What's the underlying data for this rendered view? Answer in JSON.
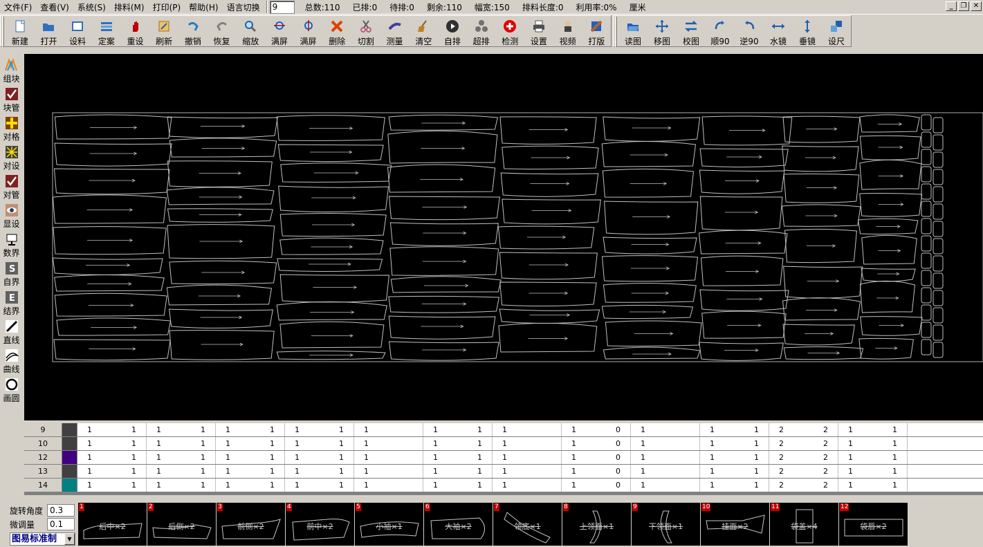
{
  "menu": {
    "items": [
      "文件(F)",
      "查看(V)",
      "系统(S)",
      "排料(M)",
      "打印(P)",
      "帮助(H)",
      "语言切换"
    ],
    "layer_value": "9",
    "stats": [
      "总数:110",
      "已排:0",
      "待排:0",
      "剩余:110",
      "幅宽:150",
      "排料长度:0",
      "利用率:0%",
      "厘米"
    ]
  },
  "window_buttons": [
    "_",
    "❐",
    "✕"
  ],
  "toolbar": {
    "group1": [
      {
        "label": "新建",
        "icon": "new-file-icon",
        "color": "#3070c0"
      },
      {
        "label": "打开",
        "icon": "open-folder-icon",
        "color": "#3070c0"
      },
      {
        "label": "设料",
        "icon": "material-icon",
        "color": "#3070c0"
      },
      {
        "label": "定案",
        "icon": "layout-icon",
        "color": "#3070c0"
      },
      {
        "label": "重设",
        "icon": "hand-icon",
        "color": "#c00000"
      },
      {
        "label": "刷新",
        "icon": "refresh-icon",
        "color": "#a07020"
      },
      {
        "label": "撤销",
        "icon": "undo-icon",
        "color": "#2080c0"
      },
      {
        "label": "恢复",
        "icon": "redo-icon",
        "color": "#808080"
      },
      {
        "label": "缩放",
        "icon": "zoom-icon",
        "color": "#2060b0"
      },
      {
        "label": "满屏",
        "icon": "fit-screen-icon",
        "color": "#2060b0"
      },
      {
        "label": "满屏",
        "icon": "fit-screen-v-icon",
        "color": "#2060b0"
      },
      {
        "label": "删除",
        "icon": "delete-icon",
        "color": "#e04000"
      },
      {
        "label": "切割",
        "icon": "cut-icon",
        "color": "#c06080"
      },
      {
        "label": "测量",
        "icon": "measure-icon",
        "color": "#4040a0"
      },
      {
        "label": "清空",
        "icon": "broom-icon",
        "color": "#c08020"
      },
      {
        "label": "自排",
        "icon": "play-icon",
        "color": "#303030"
      },
      {
        "label": "超排",
        "icon": "cluster-icon",
        "color": "#707070"
      },
      {
        "label": "检测",
        "icon": "check-icon",
        "color": "#e00000"
      },
      {
        "label": "设置",
        "icon": "printer-icon",
        "color": "#505050"
      },
      {
        "label": "视频",
        "icon": "video-icon",
        "color": "#404040"
      },
      {
        "label": "打版",
        "icon": "pattern-icon",
        "color": "#c06020"
      }
    ],
    "group2": [
      {
        "label": "读图",
        "icon": "read-folder-icon",
        "color": "#2060b0"
      },
      {
        "label": "移图",
        "icon": "move-icon",
        "color": "#2060b0"
      },
      {
        "label": "校图",
        "icon": "swap-icon",
        "color": "#2060b0"
      },
      {
        "label": "顺90",
        "icon": "rotate-cw-icon",
        "color": "#2060b0"
      },
      {
        "label": "逆90",
        "icon": "rotate-ccw-icon",
        "color": "#2060b0"
      },
      {
        "label": "水镜",
        "icon": "mirror-h-icon",
        "color": "#2060b0"
      },
      {
        "label": "垂镜",
        "icon": "mirror-v-icon",
        "color": "#2060b0"
      },
      {
        "label": "设尺",
        "icon": "ruler-icon",
        "color": "#2060b0"
      }
    ]
  },
  "sidebar": [
    {
      "label": "组块",
      "icon": "group-block-icon"
    },
    {
      "label": "块管",
      "icon": "block-manage-icon"
    },
    {
      "label": "对格",
      "icon": "grid-align-icon"
    },
    {
      "label": "对设",
      "icon": "align-set-icon"
    },
    {
      "label": "对管",
      "icon": "align-manage-icon"
    },
    {
      "label": "显设",
      "icon": "eye-icon"
    },
    {
      "label": "数界",
      "icon": "monitor-icon"
    },
    {
      "label": "自界",
      "icon": "s-bound-icon"
    },
    {
      "label": "结界",
      "icon": "e-bound-icon"
    },
    {
      "label": "直线",
      "icon": "line-icon"
    },
    {
      "label": "曲线",
      "icon": "curve-icon"
    },
    {
      "label": "画圆",
      "icon": "circle-icon"
    }
  ],
  "grid": {
    "rows": [
      {
        "id": "9",
        "color": "#404040",
        "cells": [
          [
            "1",
            "1"
          ],
          [
            "1",
            "1"
          ],
          [
            "1",
            "1"
          ],
          [
            "1",
            "1"
          ],
          [
            "1",
            ""
          ],
          [
            "1",
            "1"
          ],
          [
            "1",
            ""
          ],
          [
            "1",
            "0"
          ],
          [
            "1",
            ""
          ],
          [
            "1",
            "1"
          ],
          [
            "2",
            "2"
          ],
          [
            "1",
            "1"
          ]
        ]
      },
      {
        "id": "10",
        "color": "#404040",
        "cells": [
          [
            "1",
            "1"
          ],
          [
            "1",
            "1"
          ],
          [
            "1",
            "1"
          ],
          [
            "1",
            "1"
          ],
          [
            "1",
            ""
          ],
          [
            "1",
            "1"
          ],
          [
            "1",
            ""
          ],
          [
            "1",
            "0"
          ],
          [
            "1",
            ""
          ],
          [
            "1",
            "1"
          ],
          [
            "2",
            "2"
          ],
          [
            "1",
            "1"
          ]
        ]
      },
      {
        "id": "12",
        "color": "#400080",
        "cells": [
          [
            "1",
            "1"
          ],
          [
            "1",
            "1"
          ],
          [
            "1",
            "1"
          ],
          [
            "1",
            "1"
          ],
          [
            "1",
            ""
          ],
          [
            "1",
            "1"
          ],
          [
            "1",
            ""
          ],
          [
            "1",
            "0"
          ],
          [
            "1",
            ""
          ],
          [
            "1",
            "1"
          ],
          [
            "2",
            "2"
          ],
          [
            "1",
            "1"
          ]
        ]
      },
      {
        "id": "13",
        "color": "#404040",
        "cells": [
          [
            "1",
            "1"
          ],
          [
            "1",
            "1"
          ],
          [
            "1",
            "1"
          ],
          [
            "1",
            "1"
          ],
          [
            "1",
            ""
          ],
          [
            "1",
            "1"
          ],
          [
            "1",
            ""
          ],
          [
            "1",
            "0"
          ],
          [
            "1",
            ""
          ],
          [
            "1",
            "1"
          ],
          [
            "2",
            "2"
          ],
          [
            "1",
            "1"
          ]
        ]
      },
      {
        "id": "14",
        "color": "#008080",
        "cells": [
          [
            "1",
            "1"
          ],
          [
            "1",
            "1"
          ],
          [
            "1",
            "1"
          ],
          [
            "1",
            "1"
          ],
          [
            "1",
            ""
          ],
          [
            "1",
            "1"
          ],
          [
            "1",
            ""
          ],
          [
            "1",
            "0"
          ],
          [
            "1",
            ""
          ],
          [
            "1",
            "1"
          ],
          [
            "2",
            "2"
          ],
          [
            "1",
            "1"
          ]
        ]
      }
    ]
  },
  "params": {
    "rotate_label": "旋转角度",
    "rotate_value": "0.3",
    "fine_label": "微调量",
    "fine_value": "0.1",
    "standard": "图易标准制"
  },
  "pieces": [
    {
      "num": "1",
      "name": "后中×2"
    },
    {
      "num": "2",
      "name": "后侧×2"
    },
    {
      "num": "3",
      "name": "前侧×2"
    },
    {
      "num": "4",
      "name": "前中×2"
    },
    {
      "num": "5",
      "name": "小袖×1"
    },
    {
      "num": "6",
      "name": "大袖×2"
    },
    {
      "num": "7",
      "name": "领底×1"
    },
    {
      "num": "8",
      "name": "上领面×1"
    },
    {
      "num": "9",
      "name": "下领面×1"
    },
    {
      "num": "10",
      "name": "挂面×2"
    },
    {
      "num": "11",
      "name": "袋盖×4"
    },
    {
      "num": "12",
      "name": "袋唇×2"
    }
  ]
}
